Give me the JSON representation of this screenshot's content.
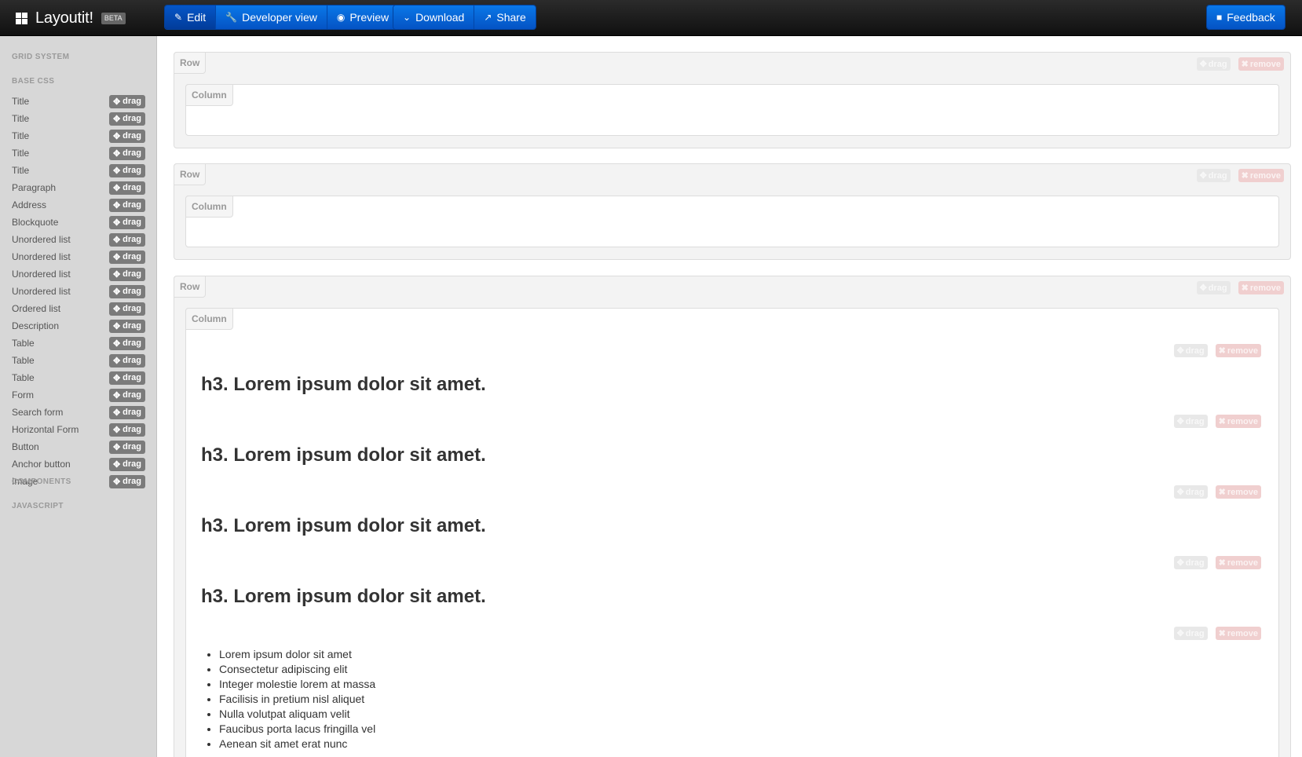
{
  "navbar": {
    "brand": "Layoutit!",
    "beta": "BETA",
    "mode_buttons": [
      {
        "label": "Edit",
        "icon": "edit-icon"
      },
      {
        "label": "Developer view",
        "icon": "wrench-icon"
      },
      {
        "label": "Preview",
        "icon": "eye-icon"
      }
    ],
    "action_buttons": [
      {
        "label": "Download",
        "icon": "chevron-down-icon"
      },
      {
        "label": "Share",
        "icon": "share-icon"
      }
    ],
    "feedback": {
      "label": "Feedback",
      "icon": "comment-icon"
    }
  },
  "sidebar": {
    "sections": {
      "grid": "GRID SYSTEM",
      "base": "BASE CSS",
      "components": "COMPONENTS",
      "javascript": "JAVASCRIPT"
    },
    "drag_label": "drag",
    "items": [
      "Title",
      "Title",
      "Title",
      "Title",
      "Title",
      "Paragraph",
      "Address",
      "Blockquote",
      "Unordered list",
      "Unordered list",
      "Unordered list",
      "Unordered list",
      "Ordered list",
      "Description",
      "Table",
      "Table",
      "Table",
      "Form",
      "Search form",
      "Horizontal Form",
      "Button",
      "Anchor button",
      "Image"
    ]
  },
  "canvas": {
    "row_label": "Row",
    "column_label": "Column",
    "drag_label": "drag",
    "remove_label": "remove",
    "headings": [
      "h3. Lorem ipsum dolor sit amet.",
      "h3. Lorem ipsum dolor sit amet.",
      "h3. Lorem ipsum dolor sit amet.",
      "h3. Lorem ipsum dolor sit amet."
    ],
    "list_items": [
      "Lorem ipsum dolor sit amet",
      "Consectetur adipiscing elit",
      "Integer molestie lorem at massa",
      "Facilisis in pretium nisl aliquet",
      "Nulla volutpat aliquam velit",
      "Faucibus porta lacus fringilla vel",
      "Aenean sit amet erat nunc"
    ]
  },
  "colors": {
    "navbar": "#1b1b1b",
    "button_primary": "#0a6be0",
    "sidebar_bg": "#d7d7d7",
    "drag_badge": "#7b7b7b",
    "remove_faint": "#f0cfcf"
  }
}
